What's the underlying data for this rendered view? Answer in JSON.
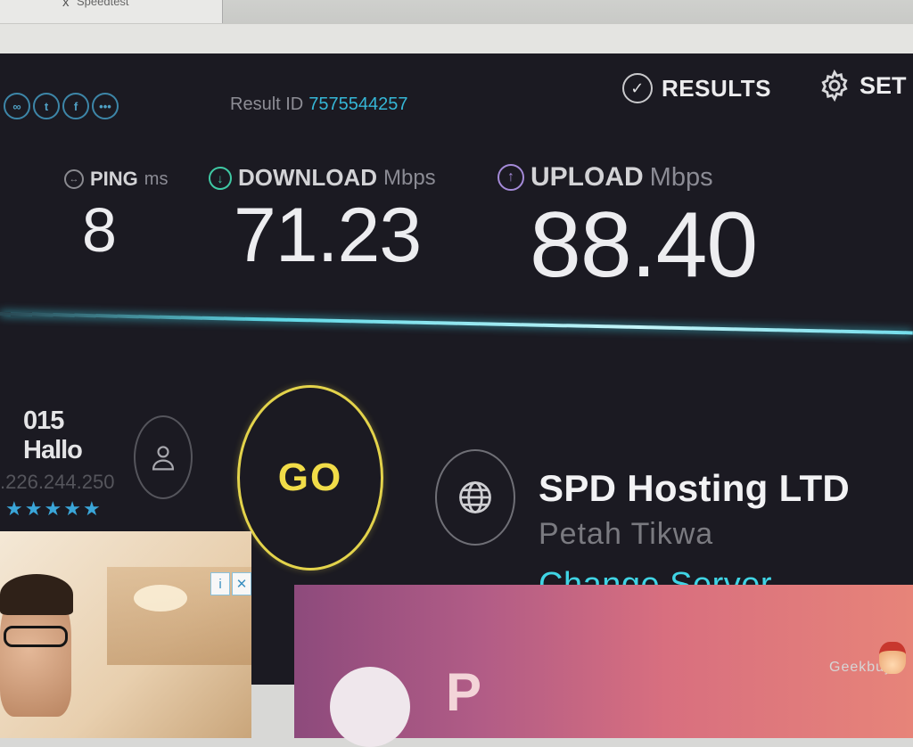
{
  "browser": {
    "tab_close": "x",
    "tab_title": "Speedtest"
  },
  "social": [
    {
      "name": "link",
      "glyph": "∞"
    },
    {
      "name": "twitter",
      "glyph": "t"
    },
    {
      "name": "facebook",
      "glyph": "f"
    },
    {
      "name": "more",
      "glyph": "•••"
    }
  ],
  "header": {
    "result_id_label": "Result ID",
    "result_id_value": "7575544257",
    "results_label": "RESULTS",
    "settings_label": "SET"
  },
  "metrics": {
    "ping": {
      "label": "PING",
      "unit": "ms",
      "value": "8"
    },
    "download": {
      "label": "DOWNLOAD",
      "unit": "Mbps",
      "value": "71.23"
    },
    "upload": {
      "label": "UPLOAD",
      "unit": "Mbps",
      "value": "88.40"
    }
  },
  "isp": {
    "name": "015 Hallo",
    "ip": ".226.244.250",
    "rating_stars": 5
  },
  "go_label": "GO",
  "server": {
    "name": "SPD Hosting LTD",
    "location": "Petah Tikwa",
    "change_label": "Change Server"
  },
  "ad": {
    "info": "i",
    "close": "✕",
    "banner_letter": "P"
  },
  "watermark": "Geekbuy",
  "colors": {
    "background": "#1b1a22",
    "accent_cyan": "#35b6d6",
    "download_green": "#3fc9a4",
    "upload_purple": "#a48ad8",
    "go_yellow": "#e3d34b",
    "star_blue": "#3aa6d9"
  }
}
